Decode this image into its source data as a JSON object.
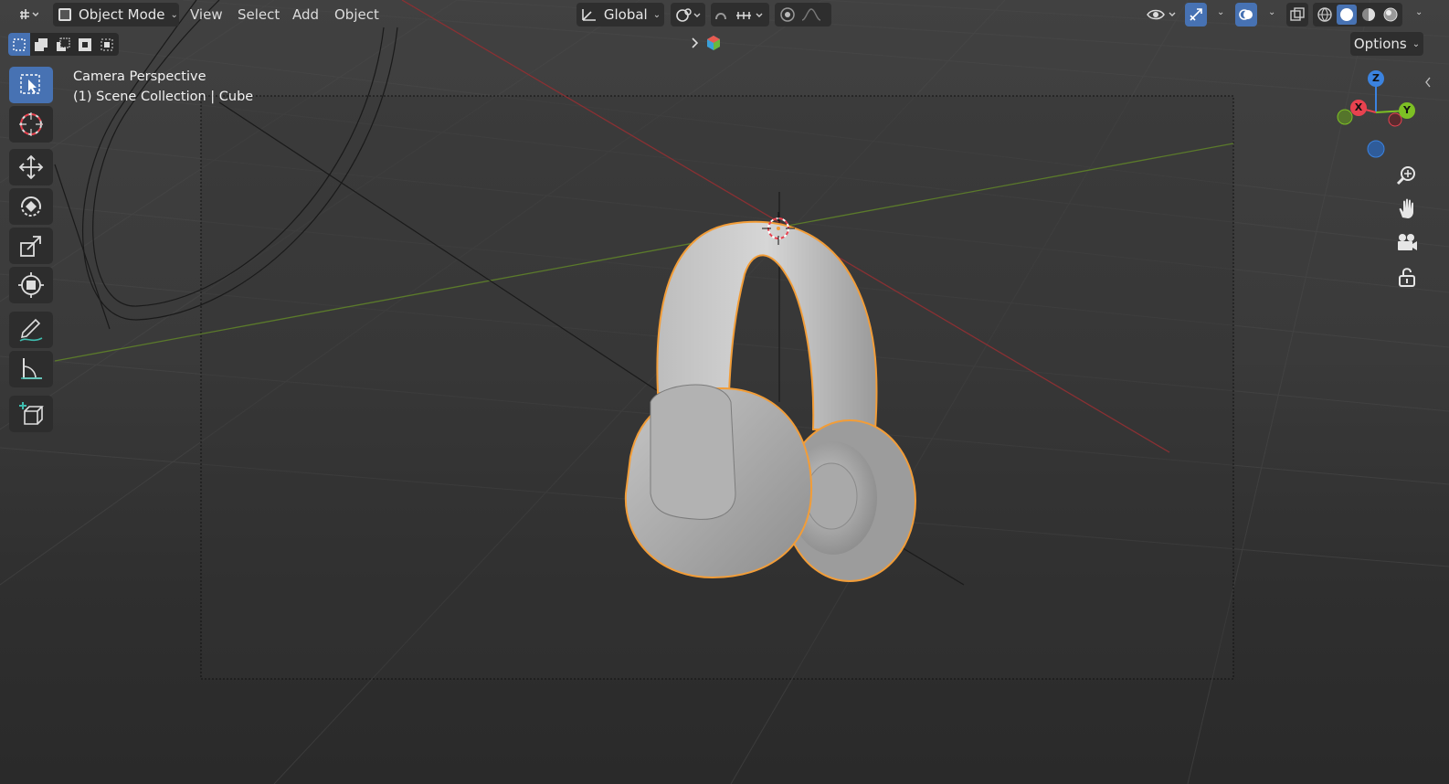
{
  "header": {
    "mode_label": "Object Mode",
    "menus": [
      "View",
      "Select",
      "Add",
      "Object"
    ],
    "orientation_label": "Global",
    "options_label": "Options"
  },
  "viewport": {
    "view_name": "Camera Perspective",
    "collection_info": "(1) Scene Collection | Cube"
  },
  "gizmo": {
    "x_label": "X",
    "y_label": "Y",
    "z_label": "Z"
  },
  "colors": {
    "accent_blue": "#4772b3",
    "selection_outline": "#f29d38",
    "x_axis": "#e8424f",
    "y_axis": "#7dc024",
    "z_axis": "#3b83e0"
  },
  "toolbar_tools": [
    "select-box-tool",
    "cursor-tool",
    "move-tool",
    "rotate-tool",
    "scale-tool",
    "transform-tool",
    "annotate-tool",
    "measure-tool",
    "add-cube-tool"
  ],
  "navigation_tools": [
    "zoom-icon",
    "pan-hand-icon",
    "camera-view-icon",
    "lock-camera-icon"
  ]
}
